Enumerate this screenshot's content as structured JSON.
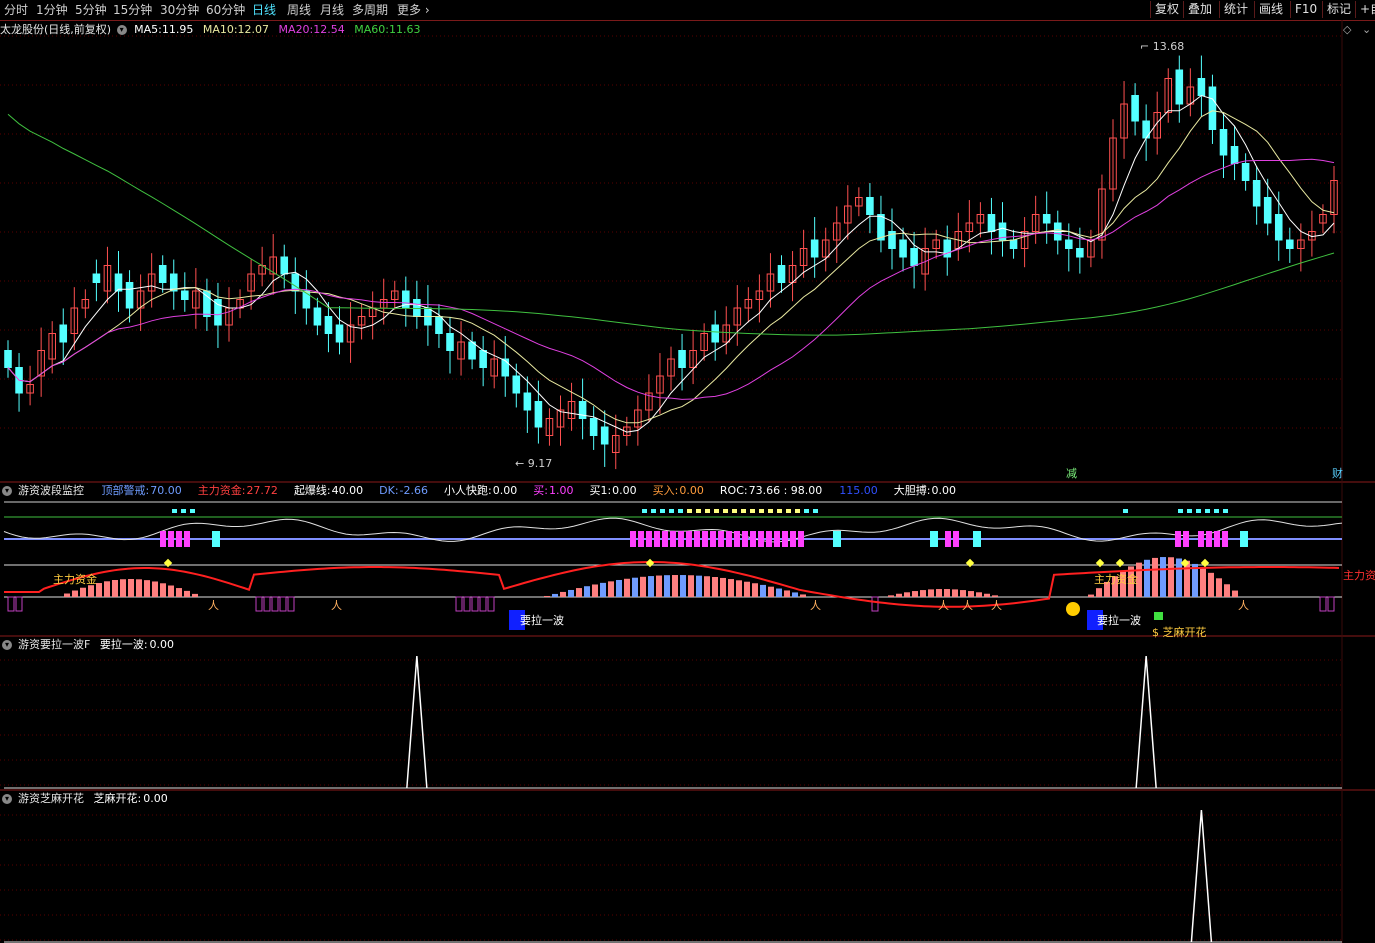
{
  "toolbar": {
    "periods": [
      "分时",
      "1分钟",
      "5分钟",
      "15分钟",
      "30分钟",
      "60分钟",
      "日线",
      "周线",
      "月线",
      "多周期",
      "更多"
    ],
    "active_period": "日线",
    "right_buttons": [
      "复权",
      "叠加",
      "统计",
      "画线",
      "F10",
      "标记",
      "+自"
    ]
  },
  "stock": {
    "name": "太龙股份(日线,前复权)",
    "ma5_label": "MA5:",
    "ma5": "11.95",
    "ma10_label": "MA10:",
    "ma10": "12.07",
    "ma20_label": "MA20:",
    "ma20": "12.54",
    "ma60_label": "MA60:",
    "ma60": "11.63",
    "high_label": "13.68",
    "low_label": "9.17",
    "marker_jian": "减",
    "marker_cai": "财"
  },
  "pane1": {
    "title": "游资波段监控",
    "items": [
      {
        "label": "顶部警戒:",
        "value": "70.00",
        "color": "#6f9cff"
      },
      {
        "label": "主力资金:",
        "value": "27.72",
        "color": "#ff4040"
      },
      {
        "label": "起爆线:",
        "value": "40.00",
        "color": "#ffffff"
      },
      {
        "label": "DK:",
        "value": "-2.66",
        "color": "#6f9cff"
      },
      {
        "label": "小人快跑:",
        "value": "0.00",
        "color": "#ffffff"
      },
      {
        "label": "买:",
        "value": "1.00",
        "color": "#ff40ff"
      },
      {
        "label": "买1:",
        "value": "0.00",
        "color": "#ffffff"
      },
      {
        "label": "买入:",
        "value": "0.00",
        "color": "#ff9b3c"
      },
      {
        "label": "ROC:",
        "value": "73.66 : 98.00",
        "color": "#ffffff"
      },
      {
        "label": "",
        "value": "115.00",
        "color": "#3050ff"
      },
      {
        "label": "大胆搏:",
        "value": "0.00",
        "color": "#ffffff"
      }
    ],
    "ann_zhuli1": "主力资金",
    "ann_zhuli2": "主力资金",
    "ann_yaola1": "要拉一波",
    "ann_yaola2": "要拉一波",
    "ann_zhima": "芝麻开花",
    "ann_side": "主力资"
  },
  "pane2": {
    "title": "游资要拉一波F",
    "item_label": "要拉一波:",
    "item_value": "0.00"
  },
  "pane3": {
    "title": "游资芝麻开花",
    "item_label": "芝麻开花:",
    "item_value": "0.00"
  },
  "colors": {
    "up": "#ff5050",
    "down": "#54ffff",
    "ma5": "#ffffff",
    "ma10": "#e8e8a0",
    "ma20": "#e040e0",
    "ma60": "#40c040",
    "grid": "#5a0000",
    "border": "#8a1a1a"
  },
  "chart_data": [
    {
      "type": "candlestick",
      "title": "太龙股份(日线,前复权)",
      "ylim": [
        8.8,
        14.0
      ],
      "series_ma": [
        {
          "name": "MA5",
          "last": 11.95
        },
        {
          "name": "MA10",
          "last": 12.07
        },
        {
          "name": "MA20",
          "last": 12.54
        },
        {
          "name": "MA60",
          "last": 11.63
        }
      ],
      "annotations": [
        {
          "text": "13.68",
          "value": 13.68
        },
        {
          "text": "9.17",
          "value": 9.17
        }
      ],
      "closes": [
        10.1,
        9.8,
        9.9,
        10.3,
        10.5,
        10.4,
        10.8,
        10.9,
        11.1,
        11.3,
        11.0,
        10.8,
        11.0,
        11.2,
        11.1,
        11.0,
        10.9,
        11.0,
        10.7,
        10.6,
        10.8,
        10.9,
        11.2,
        11.3,
        11.4,
        11.2,
        11.0,
        10.8,
        10.6,
        10.5,
        10.4,
        10.6,
        10.7,
        10.8,
        10.9,
        11.0,
        10.8,
        10.7,
        10.6,
        10.5,
        10.3,
        10.4,
        10.2,
        10.1,
        10.2,
        10.0,
        9.8,
        9.6,
        9.4,
        9.5,
        9.6,
        9.7,
        9.5,
        9.3,
        9.2,
        9.3,
        9.4,
        9.6,
        9.8,
        10.0,
        10.2,
        10.1,
        10.3,
        10.5,
        10.4,
        10.6,
        10.8,
        10.9,
        11.0,
        11.2,
        11.1,
        11.3,
        11.5,
        11.4,
        11.6,
        11.8,
        12.0,
        12.1,
        11.9,
        11.6,
        11.5,
        11.4,
        11.3,
        11.5,
        11.6,
        11.4,
        11.7,
        11.8,
        11.9,
        11.7,
        11.6,
        11.5,
        11.7,
        11.9,
        11.8,
        11.6,
        11.5,
        11.4,
        11.6,
        12.2,
        12.8,
        13.2,
        13.0,
        12.8,
        13.1,
        13.5,
        13.2,
        13.4,
        13.3,
        12.9,
        12.6,
        12.5,
        12.3,
        12.0,
        11.8,
        11.6,
        11.5,
        11.6,
        11.7,
        11.9,
        12.3
      ],
      "opens": [
        10.3,
        10.1,
        9.8,
        10.0,
        10.2,
        10.6,
        10.5,
        10.8,
        11.2,
        11.0,
        11.2,
        11.1,
        10.8,
        11.0,
        11.3,
        11.2,
        11.0,
        10.8,
        11.0,
        10.9,
        10.6,
        10.8,
        11.0,
        11.2,
        11.2,
        11.4,
        11.2,
        11.0,
        10.8,
        10.7,
        10.6,
        10.4,
        10.6,
        10.7,
        10.8,
        10.9,
        11.0,
        10.9,
        10.8,
        10.7,
        10.5,
        10.2,
        10.4,
        10.3,
        10.0,
        10.2,
        10.0,
        9.8,
        9.7,
        9.3,
        9.4,
        9.5,
        9.7,
        9.5,
        9.4,
        9.1,
        9.3,
        9.4,
        9.6,
        9.8,
        10.0,
        10.3,
        10.1,
        10.3,
        10.6,
        10.4,
        10.6,
        10.8,
        10.9,
        11.0,
        11.3,
        11.1,
        11.3,
        11.6,
        11.4,
        11.6,
        11.8,
        12.0,
        12.1,
        11.9,
        11.7,
        11.6,
        11.5,
        11.2,
        11.5,
        11.6,
        11.5,
        11.7,
        11.8,
        11.9,
        11.8,
        11.6,
        11.5,
        11.7,
        11.9,
        11.8,
        11.6,
        11.5,
        11.4,
        11.6,
        12.2,
        12.8,
        13.3,
        13.0,
        12.8,
        13.1,
        13.6,
        13.2,
        13.5,
        13.4,
        12.9,
        12.7,
        12.5,
        12.3,
        12.1,
        11.9,
        11.6,
        11.5,
        11.6,
        11.8,
        11.9
      ]
    },
    {
      "type": "line",
      "title": "游资要拉一波F",
      "ylim": [
        0,
        1
      ],
      "series": [
        {
          "name": "要拉一波",
          "spikes_at_index": [
            37,
            103
          ],
          "spike_value": 1
        }
      ]
    },
    {
      "type": "line",
      "title": "游资芝麻开花",
      "ylim": [
        0,
        1
      ],
      "series": [
        {
          "name": "芝麻开花",
          "spikes_at_index": [
            108
          ],
          "spike_value": 1
        }
      ]
    }
  ]
}
